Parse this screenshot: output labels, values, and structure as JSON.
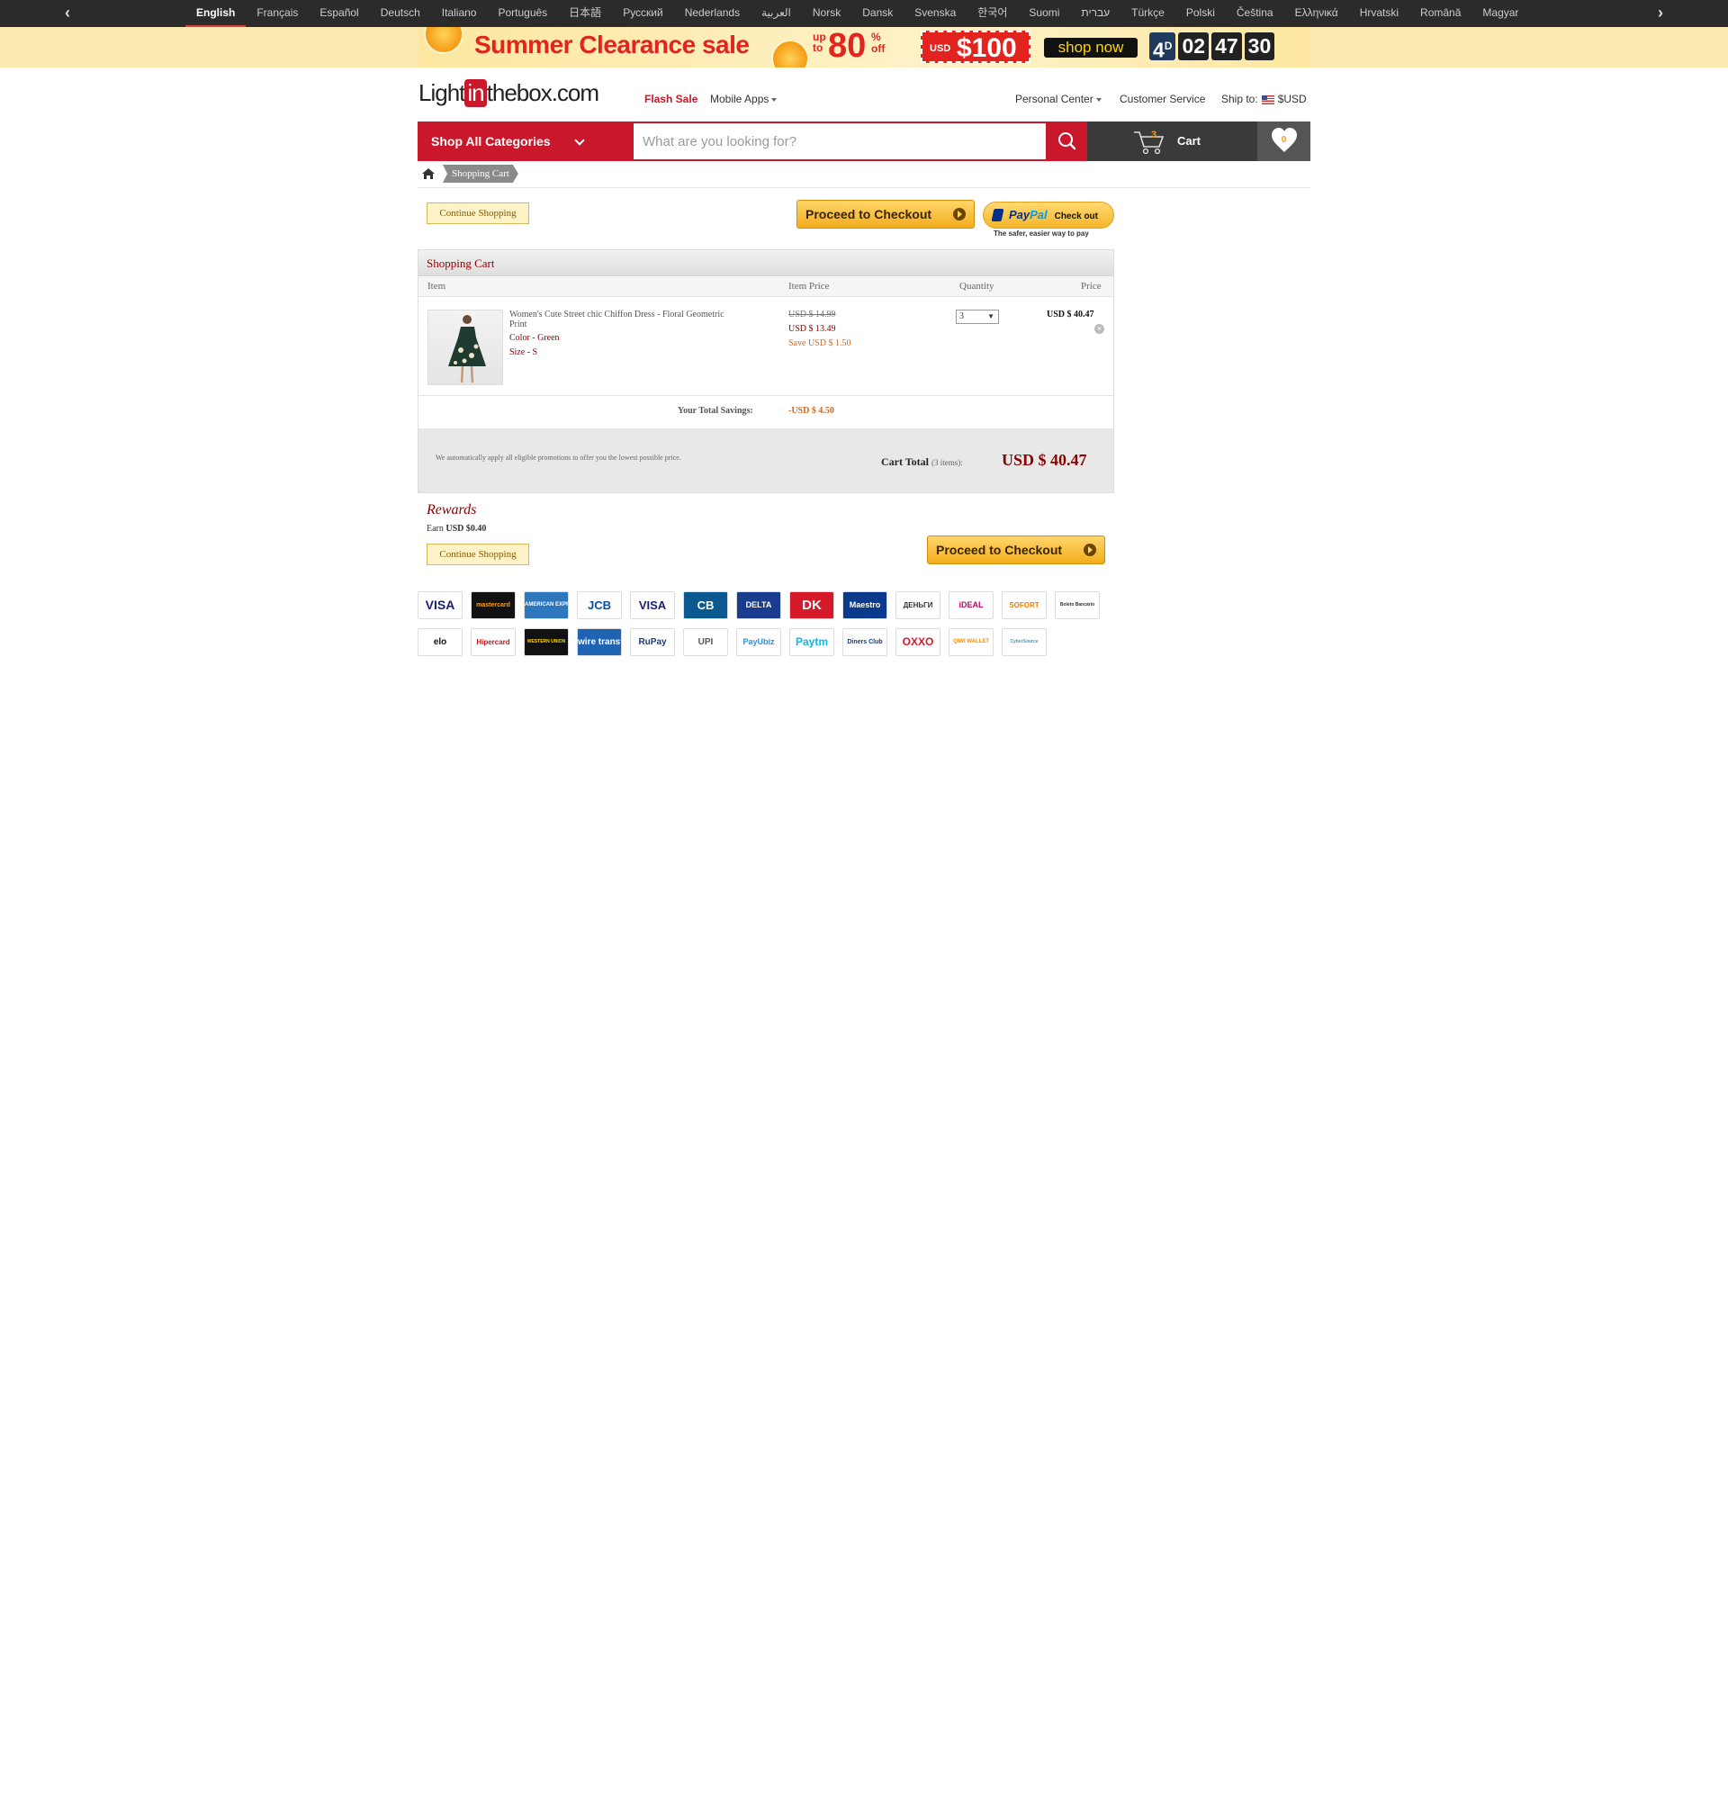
{
  "language_bar": {
    "languages": [
      "English",
      "Français",
      "Español",
      "Deutsch",
      "Italiano",
      "Português",
      "日本語",
      "Русский",
      "Nederlands",
      "العربية",
      "Norsk",
      "Dansk",
      "Svenska",
      "한국어",
      "Suomi",
      "עברית",
      "Türkçe",
      "Polski",
      "Čeština",
      "Ελληνικά",
      "Hrvatski",
      "Română",
      "Magyar"
    ],
    "active": "English"
  },
  "promo": {
    "title": "Summer Clearance sale",
    "up_to": "up to",
    "percent": "80",
    "percent_sign": "%",
    "off": "off",
    "coupon_currency": "USD",
    "coupon_amount": "$100",
    "shop_now": "shop now",
    "countdown": {
      "days": "4",
      "day_unit": "D",
      "hours": "02",
      "minutes": "47",
      "seconds": "30"
    }
  },
  "header": {
    "logo_prefix": "Light",
    "logo_in": "in",
    "logo_suffix": "thebox.com",
    "flash_sale": "Flash Sale",
    "mobile_apps": "Mobile Apps",
    "personal_center": "Personal Center",
    "customer_service": "Customer Service",
    "ship_to": "Ship to:",
    "currency": "$USD"
  },
  "nav": {
    "shop_all": "Shop All Categories",
    "search_placeholder": "What are you looking for?",
    "cart_count": "3",
    "cart_label": "Cart",
    "wishlist_count": "0"
  },
  "breadcrumb": {
    "current": "Shopping Cart"
  },
  "actions": {
    "continue_shopping": "Continue Shopping",
    "proceed_to_checkout": "Proceed to Checkout",
    "paypal_pay": "Pay",
    "paypal_pal": "Pal",
    "paypal_checkout": "Check out",
    "paypal_tagline": "The safer, easier way to pay"
  },
  "cart": {
    "heading": "Shopping Cart",
    "columns": {
      "item": "Item",
      "item_price": "Item Price",
      "quantity": "Quantity",
      "price": "Price"
    },
    "items": [
      {
        "name_line1": "Women's Cute Street chic Chiffon Dress - Floral Geometric",
        "name_line2": "Print",
        "color": "Color - Green",
        "size": "Size - S",
        "original_price": "USD $ 14.99",
        "sale_price": "USD $ 13.49",
        "save": "Save USD $ 1.50",
        "quantity": "3",
        "line_total": "USD $ 40.47"
      }
    ],
    "savings_label": "Your Total Savings:",
    "savings_value": "-USD $ 4.50",
    "promo_note": "We automatically apply all eligible promotions to offer you the lowest possible price.",
    "total_label": "Cart Total",
    "total_items": "(3 items):",
    "total_value": "USD $ 40.47"
  },
  "rewards": {
    "heading": "Rewards",
    "earn_label": "Earn",
    "earn_value": "USD $0.40"
  },
  "payments": {
    "row1": [
      "VISA",
      "mastercard",
      "AMERICAN EXPRESS",
      "JCB",
      "VISA",
      "CB",
      "DELTA",
      "DK",
      "Maestro",
      "ДЕНЬГИ",
      "iDEAL",
      "SOFORT",
      "Boleto Bancário"
    ],
    "row2": [
      "elo",
      "Hipercard",
      "WESTERN UNION",
      "wire transfer",
      "RuPay",
      "UPI",
      "PayUbiz",
      "Paytm",
      "Diners Club",
      "OXXO",
      "QIWI WALLET",
      "CyberSource"
    ]
  }
}
